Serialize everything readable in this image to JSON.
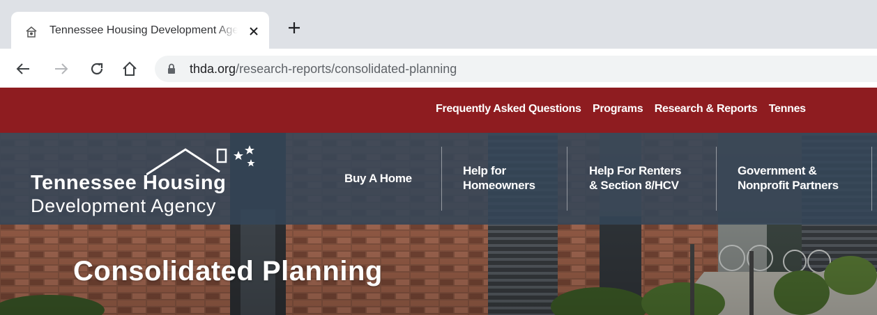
{
  "browser": {
    "tab": {
      "title": "Tennessee Housing Development Agency"
    },
    "address_bar": {
      "host": "thda.org",
      "path": "/research-reports/consolidated-planning"
    }
  },
  "site": {
    "utility_nav": [
      "Frequently Asked Questions",
      "Programs",
      "Research & Reports",
      "Tennes"
    ],
    "logo": {
      "line1": "Tennessee Housing",
      "line2": "Development Agency"
    },
    "main_nav": {
      "buy_home": "Buy A Home",
      "help_homeowners": [
        "Help for",
        "Homeowners"
      ],
      "help_renters": [
        "Help For Renters",
        "& Section 8/HCV"
      ],
      "gov_partners": [
        "Government &",
        "Nonprofit Partners"
      ]
    },
    "page_title": "Consolidated Planning"
  },
  "colors": {
    "utility_bar": "#8e1c20",
    "nav_overlay": "#344658",
    "chrome_tabstrip": "#dee1e6"
  }
}
